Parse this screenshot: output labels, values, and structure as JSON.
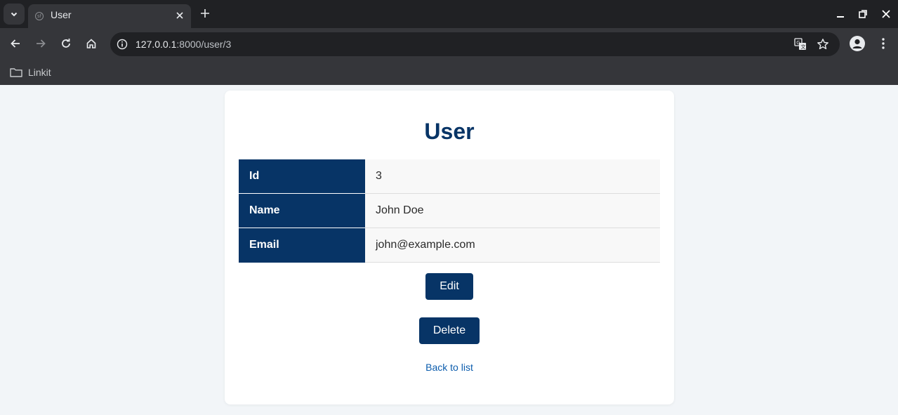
{
  "browser": {
    "tab_title": "User",
    "tab_favicon": "sf",
    "url_host": "127.0.0.1",
    "url_path": ":8000/user/3",
    "bookmarks": [
      {
        "label": "Linkit",
        "icon": "folder-icon"
      }
    ],
    "icons": {
      "tab_menu": "chevron-down-icon",
      "tab_close": "close-icon",
      "new_tab": "plus-icon",
      "back": "arrow-left-icon",
      "forward": "arrow-right-icon",
      "reload": "reload-icon",
      "home": "home-icon",
      "site_info": "info-icon",
      "translate": "translate-icon",
      "bookmark_star": "star-icon",
      "profile": "profile-icon",
      "menu": "kebab-menu-icon",
      "minimize": "minimize-icon",
      "restore": "restore-icon",
      "close_window": "close-icon"
    }
  },
  "page": {
    "title": "User",
    "fields": [
      {
        "label": "Id",
        "value": "3"
      },
      {
        "label": "Name",
        "value": "John Doe"
      },
      {
        "label": "Email",
        "value": "john@example.com"
      }
    ],
    "edit_label": "Edit",
    "delete_label": "Delete",
    "back_link": "Back to list"
  },
  "colors": {
    "primary": "#073466",
    "link": "#0b5cad",
    "page_background": "#f2f5f8"
  }
}
